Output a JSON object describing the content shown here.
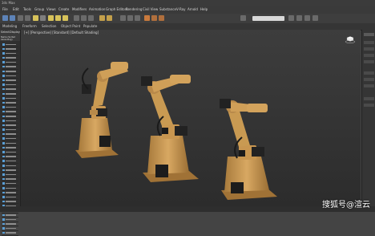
{
  "app": {
    "title": "3ds Max"
  },
  "menu": [
    "File",
    "Edit",
    "Tools",
    "Group",
    "Views",
    "Create",
    "Modifiers",
    "Animation",
    "Graph Editors",
    "Rendering",
    "Civil View",
    "Substance",
    "V-Ray",
    "Arnold",
    "Help"
  ],
  "ribbon": [
    "Modeling",
    "Freeform",
    "Selection",
    "Object Paint",
    "Populate"
  ],
  "left_panel": {
    "tab1": "Select",
    "tab2": "Display",
    "name_header": "Name (Sorted Ascending)"
  },
  "viewport": {
    "label": "[+] [Perspective] [Standard] [Default Shading]"
  },
  "watermark": "搜狐号@渲云",
  "colors": {
    "robot": "#c99a52",
    "robot_dark": "#8b6630",
    "base_black": "#1c1c1c"
  }
}
